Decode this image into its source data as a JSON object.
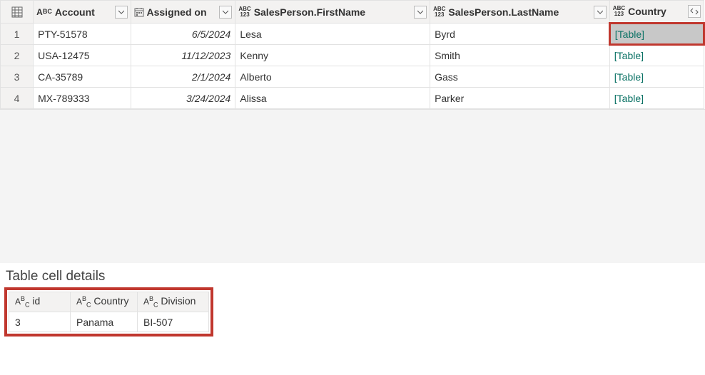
{
  "columns": {
    "account": "Account",
    "assigned": "Assigned on",
    "first": "SalesPerson.FirstName",
    "last": "SalesPerson.LastName",
    "country": "Country"
  },
  "rows": [
    {
      "num": "1",
      "account": "PTY-51578",
      "assigned": "6/5/2024",
      "first": "Lesa",
      "last": "Byrd",
      "country": "[Table]"
    },
    {
      "num": "2",
      "account": "USA-12475",
      "assigned": "11/12/2023",
      "first": "Kenny",
      "last": "Smith",
      "country": "[Table]"
    },
    {
      "num": "3",
      "account": "CA-35789",
      "assigned": "2/1/2024",
      "first": "Alberto",
      "last": "Gass",
      "country": "[Table]"
    },
    {
      "num": "4",
      "account": "MX-789333",
      "assigned": "3/24/2024",
      "first": "Alissa",
      "last": "Parker",
      "country": "[Table]"
    }
  ],
  "details": {
    "title": "Table cell details",
    "columns": {
      "id": "id",
      "country": "Country",
      "division": "Division"
    },
    "row": {
      "id": "3",
      "country": "Panama",
      "division": "BI-507"
    }
  }
}
